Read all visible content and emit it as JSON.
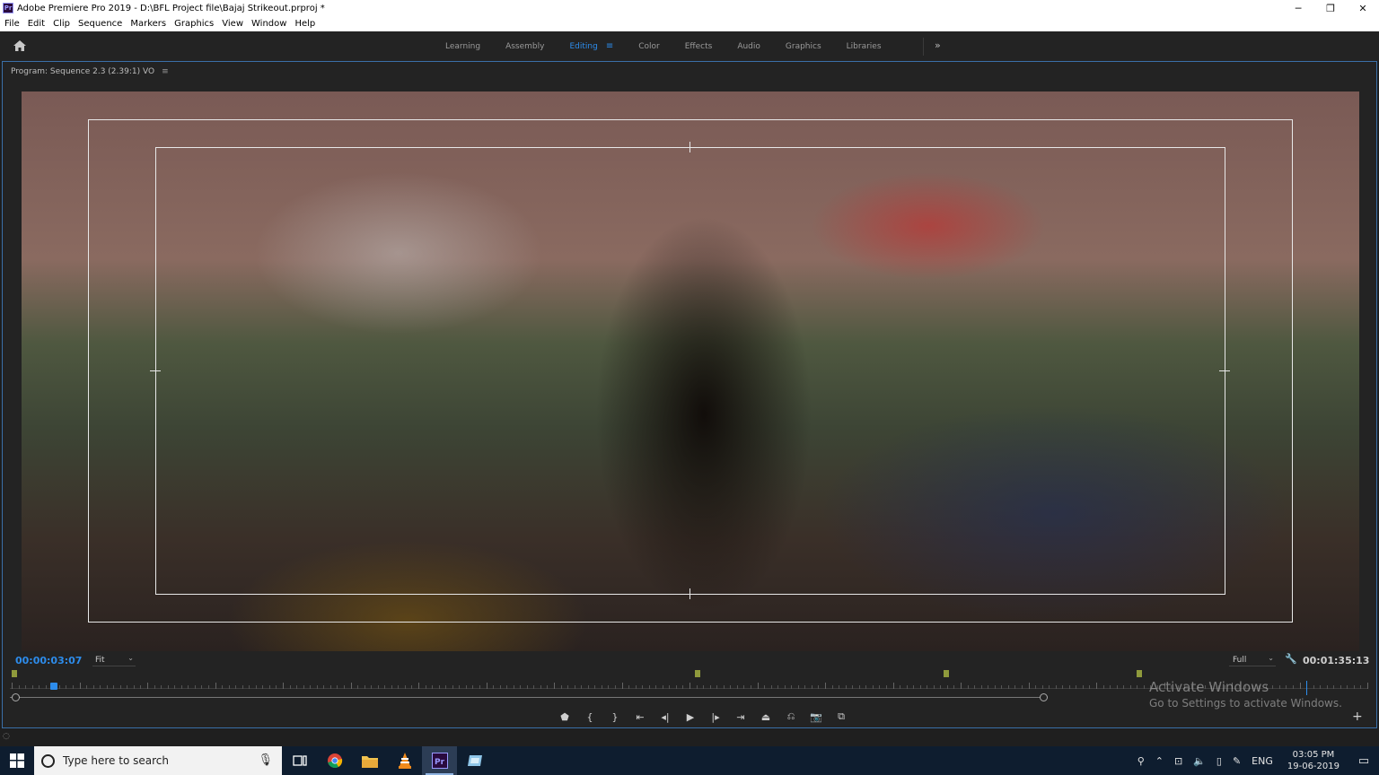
{
  "window": {
    "title": "Adobe Premiere Pro 2019 - D:\\BFL Project file\\Bajaj Strikeout.prproj *",
    "app_icon": "Pr",
    "controls": {
      "minimize": "─",
      "restore": "❐",
      "close": "✕"
    }
  },
  "menu": [
    "File",
    "Edit",
    "Clip",
    "Sequence",
    "Markers",
    "Graphics",
    "View",
    "Window",
    "Help"
  ],
  "workspaces": {
    "tabs": [
      "Learning",
      "Assembly",
      "Editing",
      "Color",
      "Effects",
      "Audio",
      "Graphics",
      "Libraries"
    ],
    "active": "Editing",
    "active_menu": "≡",
    "more": "»"
  },
  "program_monitor": {
    "title": "Program: Sequence 2.3 (2.39:1) VO",
    "menu": "≡",
    "current_timecode": "00:00:03:07",
    "zoom": "Fit",
    "resolution": "Full",
    "duration_timecode": "00:01:35:13",
    "playhead_position": 0.03
  },
  "transport": {
    "add_marker": "⬟",
    "mark_in": "{",
    "mark_out": "}",
    "go_to_in": "⇤",
    "step_back": "◂|",
    "play": "▶",
    "step_forward": "|▸",
    "go_to_out": "⇥",
    "lift": "⏏",
    "extract": "⎌",
    "export_frame": "📷",
    "compare": "⧉",
    "add": "+"
  },
  "watermark": {
    "line1": "Activate Windows",
    "line2": "Go to Settings to activate Windows."
  },
  "taskbar": {
    "search_placeholder": "Type here to search",
    "apps": [
      "task-view",
      "chrome",
      "file-explorer",
      "vlc",
      "premiere-pro",
      "other-app"
    ],
    "active_app": "premiere-pro",
    "tray_lang": "ENG",
    "time": "03:05 PM",
    "date": "19-06-2019"
  },
  "colors": {
    "accent": "#2d8ceb",
    "marker": "#8f9a3c"
  }
}
